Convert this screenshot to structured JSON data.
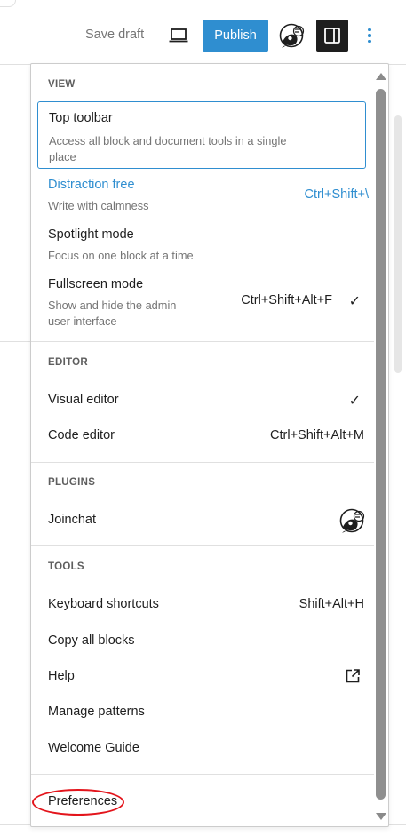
{
  "toolbar": {
    "save_draft": "Save draft",
    "publish": "Publish",
    "preview_icon": "laptop-icon",
    "joinchat_icon": "joinchat-icon",
    "settings_icon": "sidebar-toggle-icon",
    "more_icon": "vertical-ellipsis-icon",
    "accent_color": "#2f8ed0"
  },
  "menu": {
    "view": {
      "heading": "VIEW",
      "items": [
        {
          "label": "Top toolbar",
          "desc": "Access all block and document tools in a single place"
        },
        {
          "label": "Distraction free",
          "desc": "Write with calmness",
          "shortcut": "Ctrl+Shift+\\"
        },
        {
          "label": "Spotlight mode",
          "desc": "Focus on one block at a time"
        },
        {
          "label": "Fullscreen mode",
          "desc": "Show and hide the admin user interface",
          "shortcut": "Ctrl+Shift+Alt+F",
          "checked": true
        }
      ]
    },
    "editor": {
      "heading": "EDITOR",
      "items": [
        {
          "label": "Visual editor",
          "checked": true
        },
        {
          "label": "Code editor",
          "shortcut": "Ctrl+Shift+Alt+M"
        }
      ]
    },
    "plugins": {
      "heading": "PLUGINS",
      "items": [
        {
          "label": "Joinchat",
          "icon": "joinchat-icon"
        }
      ]
    },
    "tools": {
      "heading": "TOOLS",
      "items": [
        {
          "label": "Keyboard shortcuts",
          "shortcut": "Shift+Alt+H"
        },
        {
          "label": "Copy all blocks"
        },
        {
          "label": "Help",
          "icon": "external-link-icon"
        },
        {
          "label": "Manage patterns"
        },
        {
          "label": "Welcome Guide"
        }
      ]
    },
    "preferences": {
      "label": "Preferences"
    }
  },
  "check_glyph": "✓"
}
